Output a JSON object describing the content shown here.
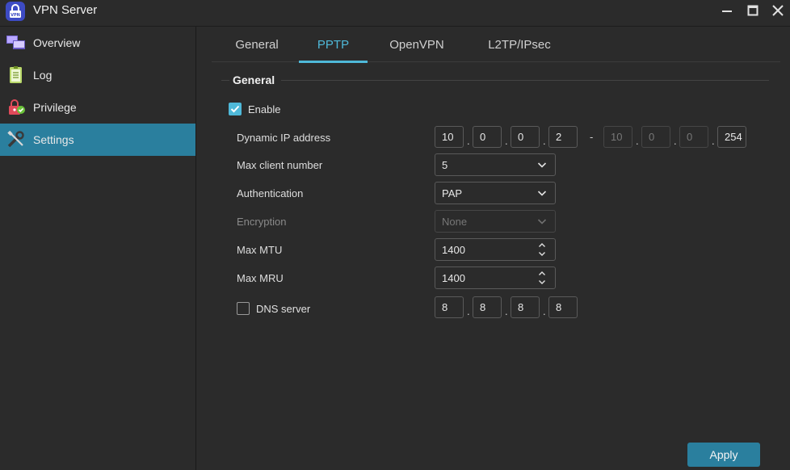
{
  "window": {
    "title": "VPN Server",
    "icon": "vpn-lock-icon",
    "controls": [
      "minimize-icon",
      "maximize-icon",
      "close-icon"
    ]
  },
  "sidebar": {
    "items": [
      {
        "label": "Overview",
        "icon": "overview-monitor-icon",
        "active": false
      },
      {
        "label": "Log",
        "icon": "log-notepad-icon",
        "active": false
      },
      {
        "label": "Privilege",
        "icon": "privilege-lock-check-icon",
        "active": false
      },
      {
        "label": "Settings",
        "icon": "settings-tools-icon",
        "active": true
      }
    ]
  },
  "tabs": [
    {
      "label": "General",
      "active": false
    },
    {
      "label": "PPTP",
      "active": true
    },
    {
      "label": "OpenVPN",
      "active": false
    },
    {
      "label": "L2TP/IPsec",
      "active": false
    }
  ],
  "section": {
    "title": "General",
    "enable": {
      "label": "Enable",
      "checked": true
    },
    "dynamic_ip": {
      "label": "Dynamic IP address",
      "start": [
        "10",
        "0",
        "0",
        "2"
      ],
      "separator": "-",
      "end": [
        "10",
        "0",
        "0",
        "254"
      ]
    },
    "max_client": {
      "label": "Max client number",
      "value": "5"
    },
    "authentication": {
      "label": "Authentication",
      "value": "PAP"
    },
    "encryption": {
      "label": "Encryption",
      "value": "None",
      "disabled": true
    },
    "max_mtu": {
      "label": "Max MTU",
      "value": "1400"
    },
    "max_mru": {
      "label": "Max MRU",
      "value": "1400"
    },
    "dns_server": {
      "label": "DNS server",
      "checked": false,
      "octets": [
        "8",
        "8",
        "8",
        "8"
      ]
    }
  },
  "apply_label": "Apply",
  "colors": {
    "accent": "#4fb9d9",
    "active_bg": "#2a7f9e",
    "background": "#2b2b2b"
  }
}
